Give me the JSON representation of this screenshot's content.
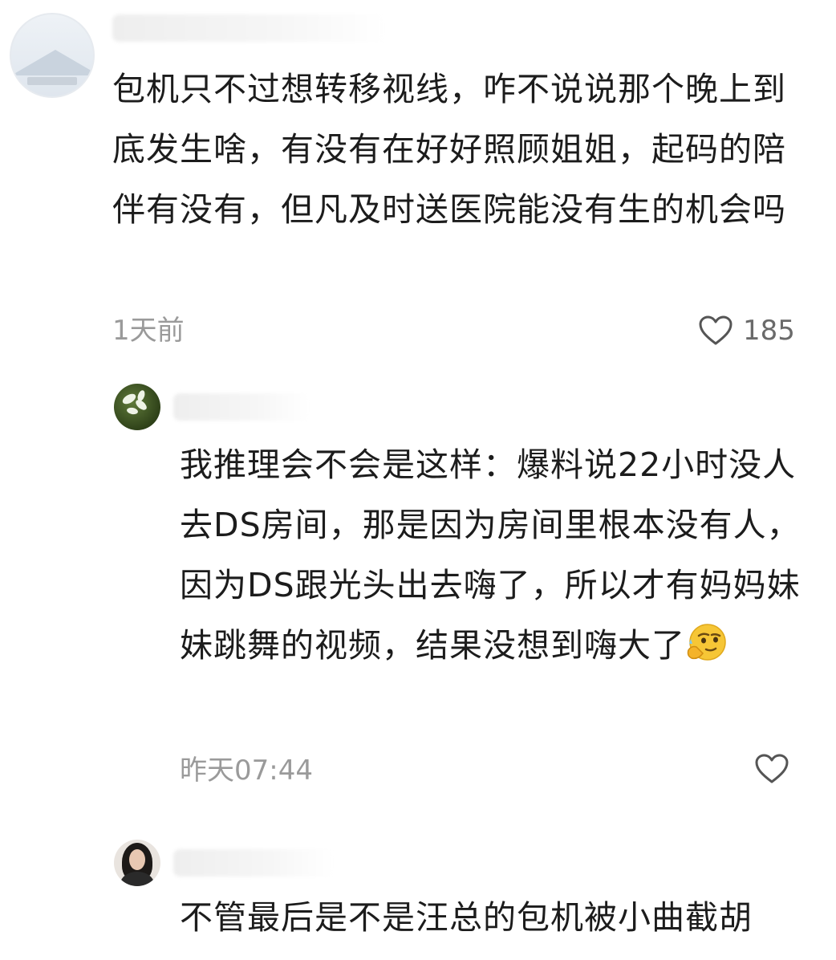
{
  "comments": [
    {
      "text": "包机只不过想转移视线，咋不说说那个晚上到底发生啥，有没有在好好照顾姐姐，起码的陪伴有没有，但凡及时送医院能没有生的机会吗",
      "time": "1天前",
      "likes": "185"
    },
    {
      "text": "我推理会不会是这样：爆料说22小时没人去DS房间，那是因为房间里根本没有人，因为DS跟光头出去嗨了，所以才有妈妈妹妹跳舞的视频，结果没想到嗨大了",
      "emoji": "thinking-face",
      "time": "昨天07:44",
      "likes": ""
    },
    {
      "text": "不管最后是不是汪总的包机被小曲截胡"
    }
  ],
  "colors": {
    "text": "#1c1c1c",
    "meta": "#9a9a9a",
    "icon": "#555555"
  },
  "icons": {
    "like": "heart-outline-icon"
  }
}
